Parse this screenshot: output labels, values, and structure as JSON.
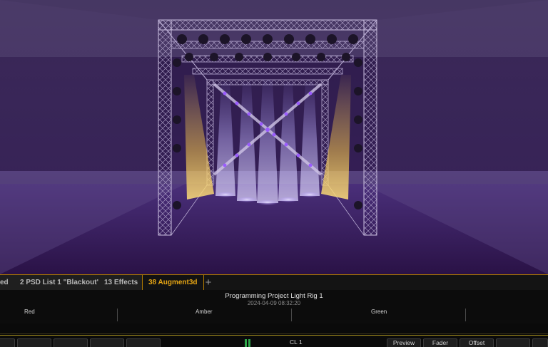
{
  "tabs": [
    {
      "label": "ed",
      "active": false
    },
    {
      "label": "2 PSD List 1 \"Blackout\"",
      "active": false
    },
    {
      "label": "13 Effects",
      "active": false
    },
    {
      "label": "38 Augment3d",
      "active": true
    }
  ],
  "tab_add_label": "+",
  "project": {
    "title": "Programming Project Light Rig 1",
    "timestamp": "2024-04-09 08:32:20"
  },
  "columns": [
    "Red",
    "Amber",
    "Green"
  ],
  "cue_list": "CL 1",
  "softkeys": [
    "Preview",
    "Fader",
    "Offset"
  ],
  "colors": {
    "accent": "#e6a514",
    "stage_bg": "#3b2459",
    "beam_violet": "#b39cff",
    "beam_amber": "#f2c14a",
    "truss": "#bfb3d4",
    "cue_indicator": "#2fa64a"
  },
  "icons": [
    "plus-icon"
  ]
}
